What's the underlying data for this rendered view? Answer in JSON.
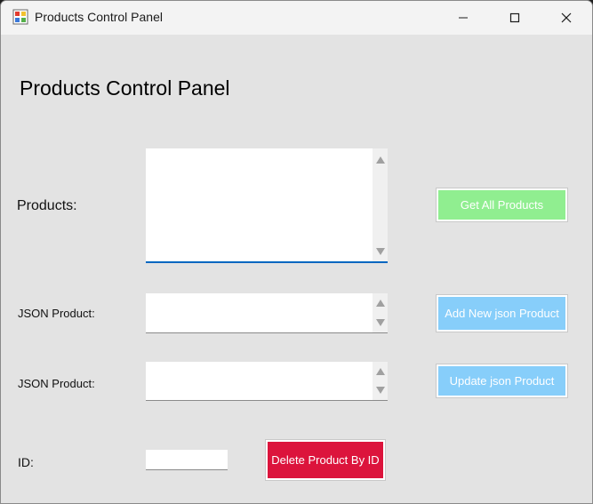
{
  "window": {
    "title": "Products Control Panel"
  },
  "heading": "Products Control Panel",
  "labels": {
    "products": "Products:",
    "json_product_1": "JSON Product:",
    "json_product_2": "JSON Product:",
    "id": "ID:"
  },
  "fields": {
    "products_value": "",
    "json_product_1_value": "",
    "json_product_2_value": "",
    "id_value": ""
  },
  "buttons": {
    "get_all": "Get All Products",
    "add_new": "Add New json Product",
    "update": "Update json Product",
    "delete": "Delete Product By ID"
  },
  "colors": {
    "get_all": "#90ee90",
    "add_update": "#87cefa",
    "delete": "#dc143c",
    "focus_underline": "#0067c0"
  }
}
